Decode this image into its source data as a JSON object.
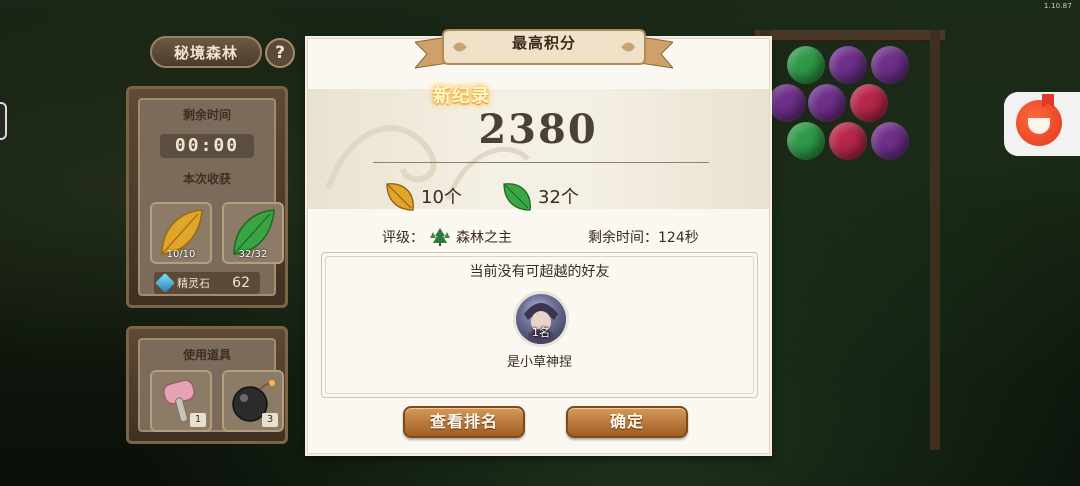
{
  "version": "1.10.87",
  "side_panel": {
    "title": "秘境森林",
    "help": "?",
    "time_left_label": "剩余时间",
    "time_left_value": "00:00",
    "harvest_label": "本次收获",
    "harvest": [
      {
        "icon": "yellow-leaf-icon",
        "count": "10/10"
      },
      {
        "icon": "green-leaf-icon",
        "count": "32/32"
      }
    ],
    "gem_label": "精灵石",
    "gem_value": "62",
    "tools_label": "使用道具",
    "tools": [
      {
        "icon": "hammer-icon",
        "count": "1"
      },
      {
        "icon": "bomb-icon",
        "count": "3"
      }
    ]
  },
  "modal": {
    "title": "最高积分",
    "new_record": "新纪录",
    "score": "2380",
    "rewards": [
      {
        "icon": "yellow-leaf-icon",
        "label": "10个"
      },
      {
        "icon": "green-leaf-icon",
        "label": "32个"
      }
    ],
    "rating_label": "评级：",
    "rating_value": "森林之主",
    "time_left_text": "剩余时间：124秒",
    "friends_message": "当前没有可超越的好友",
    "friend": {
      "rank": "1名",
      "name": "是小草神捏"
    },
    "buttons": {
      "ranking": "查看排名",
      "confirm": "确定"
    }
  },
  "colors": {
    "modal_bg": "#fbf8f1",
    "button": "#b8763a",
    "yellow_leaf": "#d99a1c",
    "green_leaf": "#2f9a3a"
  }
}
